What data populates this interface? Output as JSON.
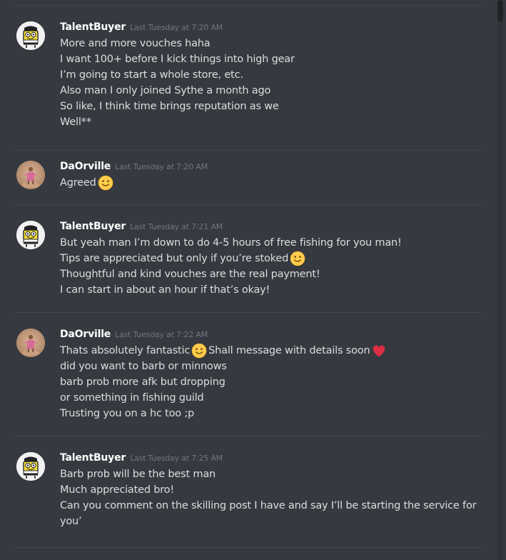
{
  "messages": [
    {
      "author": "TalentBuyer",
      "avatar": "spongebob-avatar",
      "timestamp": "Last Tuesday at 7:20 AM",
      "lines": [
        [
          "More and more vouches haha"
        ],
        [
          "I want 100+ before I kick things into high gear"
        ],
        [
          "I’m going to start a whole store, etc."
        ],
        [
          "Also man I only joined Sythe a month ago"
        ],
        [
          "So like, I think time brings reputation as we"
        ],
        [
          "Well**"
        ]
      ]
    },
    {
      "author": "DaOrville",
      "avatar": "pink-figure-avatar",
      "timestamp": "Last Tuesday at 7:20 AM",
      "lines": [
        [
          "Agreed",
          {
            "emoji": "slightly-smiling-face"
          }
        ]
      ]
    },
    {
      "author": "TalentBuyer",
      "avatar": "spongebob-avatar",
      "timestamp": "Last Tuesday at 7:21 AM",
      "lines": [
        [
          "But yeah man I’m down to do 4-5 hours of free fishing for you man!"
        ],
        [
          "Tips are appreciated but only if you’re stoked",
          {
            "emoji": "slightly-smiling-face"
          }
        ],
        [
          "Thoughtful and kind vouches are the real payment!"
        ],
        [
          "I can start in about an hour if that’s okay!"
        ]
      ]
    },
    {
      "author": "DaOrville",
      "avatar": "pink-figure-avatar",
      "timestamp": "Last Tuesday at 7:22 AM",
      "lines": [
        [
          "Thats absolutely fantastic",
          {
            "emoji": "slightly-smiling-face"
          },
          "Shall message with details soon",
          {
            "emoji": "red-heart"
          }
        ],
        [
          "did you want to barb or minnows"
        ],
        [
          "barb prob more afk but dropping"
        ],
        [
          "or something in fishing guild"
        ],
        [
          "Trusting you on a hc too ;p"
        ]
      ]
    },
    {
      "author": "TalentBuyer",
      "avatar": "spongebob-avatar",
      "timestamp": "Last Tuesday at 7:25 AM",
      "lines": [
        [
          "Barb prob will be the best man"
        ],
        [
          "Much appreciated bro!"
        ],
        [
          "Can you comment on the skilling post I have and say I’ll be starting the service for"
        ],
        [
          "you’"
        ]
      ]
    }
  ]
}
